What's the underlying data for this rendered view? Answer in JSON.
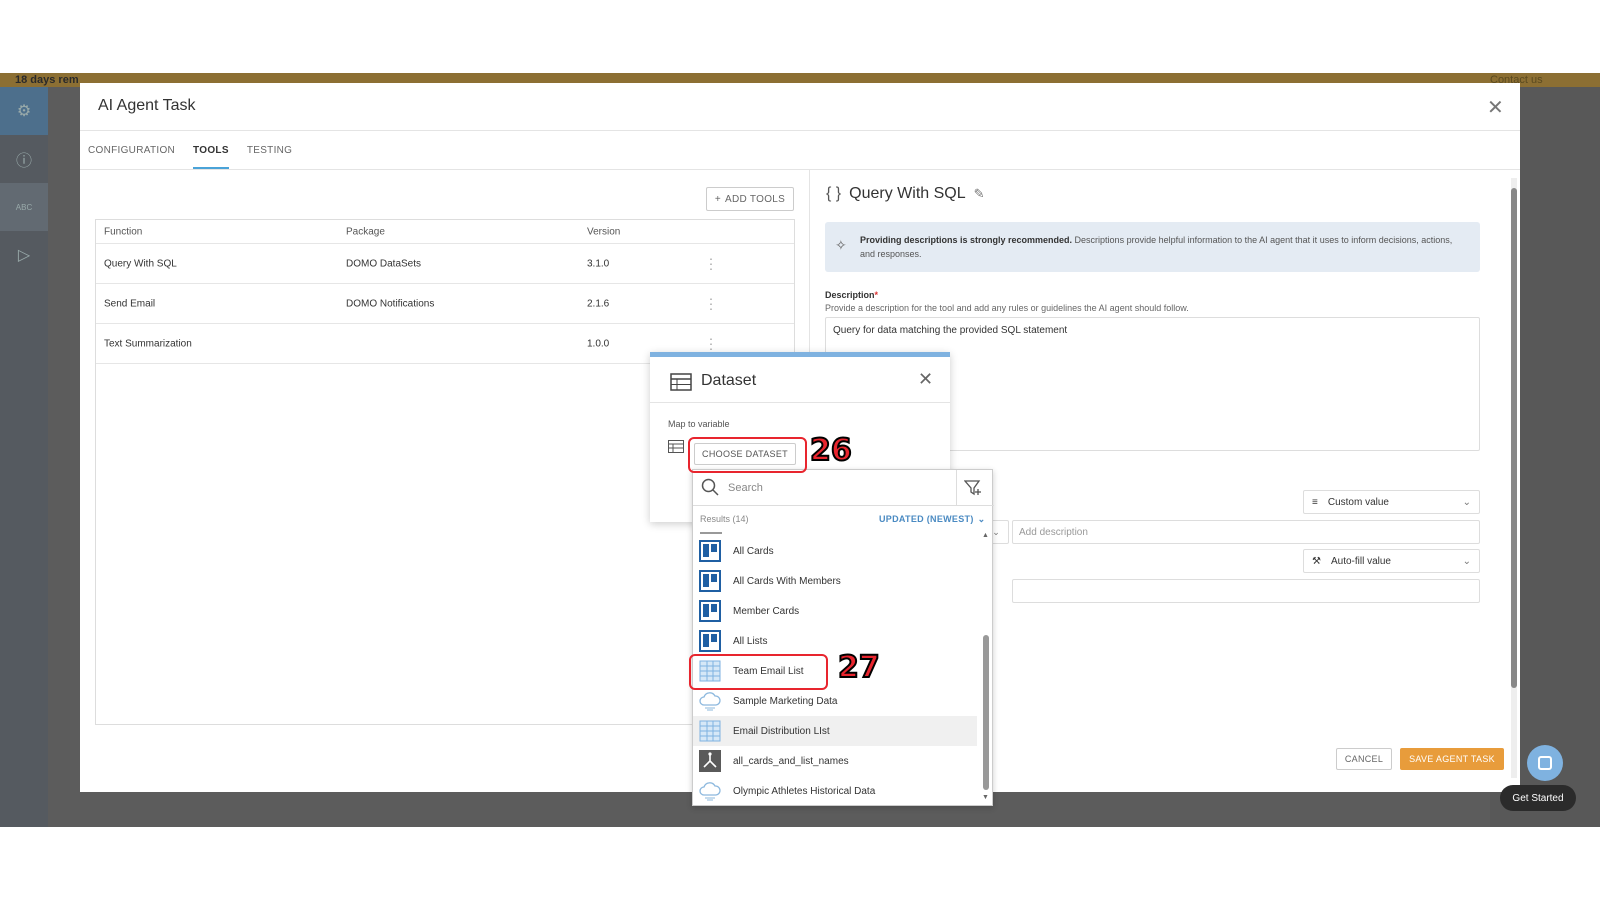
{
  "banner": {
    "trial_text": "18 days rem",
    "contact_text": "Contact us"
  },
  "modal": {
    "title": "AI Agent Task",
    "tabs": [
      "CONFIGURATION",
      "TOOLS",
      "TESTING"
    ],
    "active_tab": "TOOLS",
    "add_tools_label": "ADD TOOLS",
    "table": {
      "headers": [
        "Function",
        "Package",
        "Version"
      ],
      "rows": [
        {
          "function": "Query With SQL",
          "package": "DOMO DataSets",
          "version": "3.1.0"
        },
        {
          "function": "Send Email",
          "package": "DOMO Notifications",
          "version": "2.1.6"
        },
        {
          "function": "Text Summarization",
          "package": "",
          "version": "1.0.0"
        }
      ]
    },
    "tool_panel": {
      "title": "Query With SQL",
      "info_bold": "Providing descriptions is strongly recommended.",
      "info_text": " Descriptions provide helpful information to the AI agent that it uses to inform decisions, actions, and responses.",
      "description_label": "Description",
      "description_help": "Provide a description for the tool and add any rules or guidelines the AI agent should follow.",
      "description_value": "Query for data matching the provided SQL statement",
      "custom_value_label": "Custom value",
      "add_description_placeholder": "Add description",
      "autofill_label": "Auto-fill value"
    },
    "cancel_label": "CANCEL",
    "save_label": "SAVE AGENT TASK"
  },
  "dataset_dialog": {
    "title": "Dataset",
    "map_label": "Map to variable",
    "choose_label": "CHOOSE DATASET"
  },
  "dropdown": {
    "search_placeholder": "Search",
    "results_label": "Results (14)",
    "sort_label": "UPDATED (NEWEST)",
    "items": [
      {
        "label": "All Cards",
        "icon": "trello-icon"
      },
      {
        "label": "All Cards With Members",
        "icon": "trello-icon"
      },
      {
        "label": "Member Cards",
        "icon": "trello-icon"
      },
      {
        "label": "All Lists",
        "icon": "trello-icon"
      },
      {
        "label": "Team Email List",
        "icon": "spreadsheet-icon"
      },
      {
        "label": "Sample Marketing Data",
        "icon": "cloud-icon"
      },
      {
        "label": "Email Distribution LIst",
        "icon": "spreadsheet-icon"
      },
      {
        "label": "all_cards_and_list_names",
        "icon": "dataflow-icon"
      },
      {
        "label": "Olympic Athletes Historical Data",
        "icon": "cloud-icon"
      }
    ]
  },
  "annotations": {
    "step_a": "26",
    "step_b": "27"
  },
  "chat": {
    "get_started_label": "Get Started"
  },
  "colors": {
    "accent": "#4aa3d8",
    "save_button": "#e89c3b",
    "annotation_red": "#e8252e"
  }
}
